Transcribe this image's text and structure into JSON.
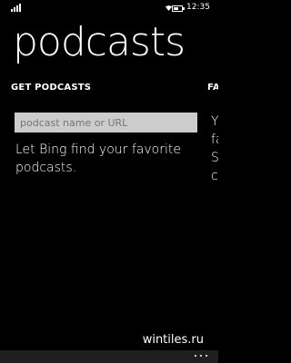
{
  "status_bar": {
    "time": "12:35",
    "battery_level": 0.6,
    "icons": [
      "signal-icon",
      "wifi-icon",
      "battery-icon"
    ]
  },
  "app": {
    "title": "podcasts"
  },
  "pivot": {
    "active_label": "GET PODCASTS",
    "next_label": "FAV"
  },
  "search": {
    "value": "",
    "placeholder": "podcast name or URL"
  },
  "hint": "Let Bing find your favorite podcasts.",
  "peek_lines": [
    "Y",
    "fa",
    "S",
    "c"
  ],
  "watermark": "wintiles.ru",
  "colors": {
    "background": "#000000",
    "text": "#ffffff",
    "input_background": "#cccccc",
    "placeholder": "#767676",
    "app_bar": "#1f1f1f"
  }
}
